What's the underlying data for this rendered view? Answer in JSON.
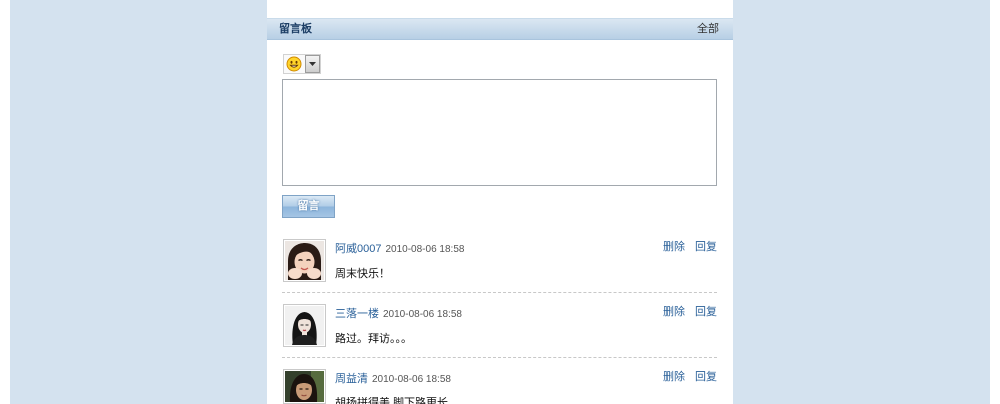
{
  "board": {
    "title": "留言板",
    "all_link": "全部"
  },
  "composer": {
    "emoji_icon": "smiley-icon",
    "dropdown_icon": "chevron-down-icon",
    "message_value": "",
    "submit_label": "留言"
  },
  "comments": [
    {
      "author": "阿威0007",
      "time": "2010-08-06 18:58",
      "message": "周末快乐！",
      "delete_label": "删除",
      "reply_label": "回复"
    },
    {
      "author": "三落一楼",
      "time": "2010-08-06 18:58",
      "message": "路过。拜访。。。",
      "delete_label": "删除",
      "reply_label": "回复"
    },
    {
      "author": "周益清",
      "time": "2010-08-06 18:58",
      "message": "胡扬拼得美 脚下路更长",
      "delete_label": "删除",
      "reply_label": "回复"
    }
  ],
  "colors": {
    "page_background": "#d4e2ef",
    "link": "#2a6099",
    "header_title": "#1d3f66"
  }
}
